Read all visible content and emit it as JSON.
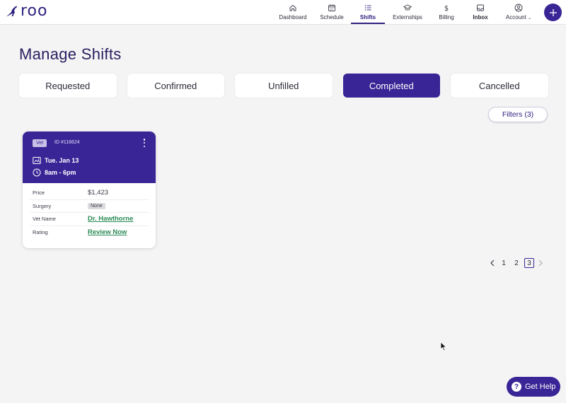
{
  "brand": {
    "name": "roo",
    "color": "#2f2380"
  },
  "nav": {
    "items": [
      {
        "label": "Dashboard",
        "icon": "home-icon"
      },
      {
        "label": "Schedule",
        "icon": "calendar-icon"
      },
      {
        "label": "Shifts",
        "icon": "list-icon",
        "active": true
      },
      {
        "label": "Externships",
        "icon": "graduation-cap-icon"
      },
      {
        "label": "Billing",
        "icon": "dollar-icon"
      },
      {
        "label": "Inbox",
        "icon": "inbox-icon"
      },
      {
        "label": "Account",
        "icon": "user-circle-icon"
      }
    ],
    "add_icon": "plus-icon"
  },
  "page": {
    "title": "Manage Shifts"
  },
  "tabs": [
    {
      "label": "Requested"
    },
    {
      "label": "Confirmed"
    },
    {
      "label": "Unfilled"
    },
    {
      "label": "Completed",
      "active": true
    },
    {
      "label": "Cancelled"
    }
  ],
  "filters": {
    "label": "Filters (3)"
  },
  "card": {
    "role": "Vet",
    "shift_id": "ID #116624",
    "date": "Tue. Jan 13",
    "time": "8am - 6pm",
    "rows": [
      {
        "key": "Price",
        "value": "$1,423"
      },
      {
        "key": "Surgery",
        "value": "None"
      },
      {
        "key": "Vet Name",
        "value": "Dr. Hawthorne"
      },
      {
        "key": "Rating",
        "value": "Review Now"
      }
    ]
  },
  "pagination": {
    "pages": [
      "1",
      "2",
      "3"
    ],
    "current": "3"
  },
  "help": {
    "label": "Get Help",
    "glyph": "?"
  },
  "colors": {
    "primary": "#3a2596",
    "link": "#2a8a55",
    "background": "#f4f4f5"
  }
}
